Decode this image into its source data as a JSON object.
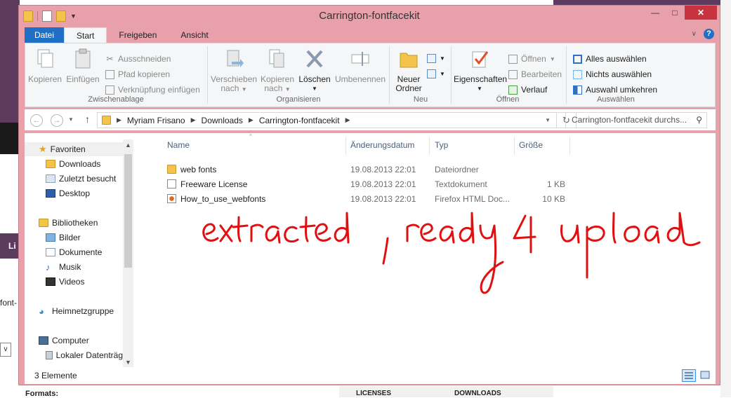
{
  "window": {
    "title": "Carrington-fontfacekit",
    "buttons": {
      "minimize": "—",
      "maximize": "□",
      "close": "✕"
    }
  },
  "ribbon": {
    "tabs": [
      "Datei",
      "Start",
      "Freigeben",
      "Ansicht"
    ],
    "active_tab": "Start",
    "groups": {
      "clipboard": {
        "label": "Zwischenablage",
        "copy": "Kopieren",
        "paste": "Einfügen",
        "cut": "Ausschneiden",
        "copy_path": "Pfad kopieren",
        "paste_shortcut": "Verknüpfung einfügen"
      },
      "organize": {
        "label": "Organisieren",
        "move_to_1": "Verschieben",
        "move_to_2": "nach",
        "copy_to_1": "Kopieren",
        "copy_to_2": "nach",
        "delete": "Löschen",
        "rename": "Umbenennen"
      },
      "new": {
        "label": "Neu",
        "new_folder_1": "Neuer",
        "new_folder_2": "Ordner"
      },
      "open": {
        "label": "Öffnen",
        "properties": "Eigenschaften",
        "open": "Öffnen",
        "edit": "Bearbeiten",
        "history": "Verlauf"
      },
      "select": {
        "label": "Auswählen",
        "select_all": "Alles auswählen",
        "select_none": "Nichts auswählen",
        "invert": "Auswahl umkehren"
      }
    }
  },
  "address": {
    "segments": [
      "Myriam Frisano",
      "Downloads",
      "Carrington-fontfacekit"
    ],
    "search_placeholder": "Carrington-fontfacekit durchs..."
  },
  "nav_pane": {
    "favorites": "Favoriten",
    "downloads": "Downloads",
    "recent": "Zuletzt besucht",
    "desktop": "Desktop",
    "libraries": "Bibliotheken",
    "pictures": "Bilder",
    "documents": "Dokumente",
    "music": "Musik",
    "videos": "Videos",
    "homegroup": "Heimnetzgruppe",
    "computer": "Computer",
    "local_disk": "Lokaler Datenträg"
  },
  "file_list": {
    "columns": [
      "Name",
      "Änderungsdatum",
      "Typ",
      "Größe"
    ],
    "rows": [
      {
        "name": "web fonts",
        "date": "19.08.2013 22:01",
        "type": "Dateiordner",
        "size": ""
      },
      {
        "name": "Freeware License",
        "date": "19.08.2013 22:01",
        "type": "Textdokument",
        "size": "1 KB"
      },
      {
        "name": "How_to_use_webfonts",
        "date": "19.08.2013 22:01",
        "type": "Firefox HTML Doc...",
        "size": "10 KB"
      }
    ]
  },
  "status": {
    "item_count": "3 Elemente"
  },
  "annotation": {
    "text": "extracted, ready 4 upload",
    "color": "#e01010"
  },
  "background_page": {
    "left_bar_text": "Li",
    "left_text": "font-",
    "left_select": "v",
    "bottom_left": "Formats:",
    "bottom_licenses": "LICENSES",
    "bottom_downloads": "DOWNLOADS"
  },
  "colors": {
    "window_frame": "#e8a0aa",
    "file_tab": "#1f6fc4",
    "close_button": "#c7343f",
    "background_purple": "#5c3b5f"
  }
}
